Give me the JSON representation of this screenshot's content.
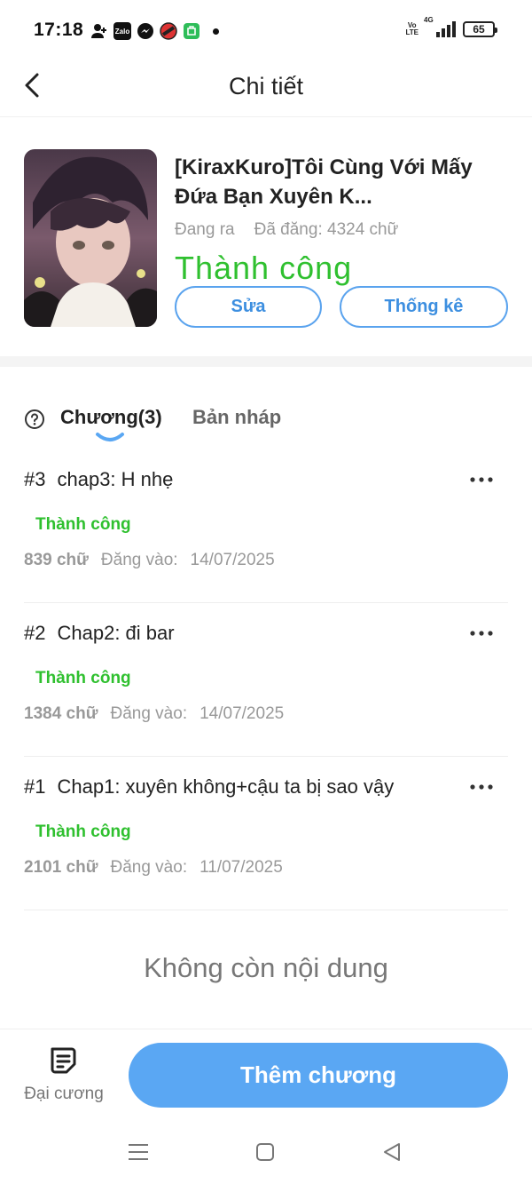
{
  "status_bar": {
    "time": "17:18",
    "battery": "65",
    "network": "4G",
    "volte_top": "Vo",
    "volte_bottom": "LTE"
  },
  "header": {
    "title": "Chi tiết"
  },
  "story": {
    "title": "[KiraxKuro]Tôi Cùng Với Mấy Đứa Bạn Xuyên K...",
    "status_text": "Đang ra",
    "word_count": "Đã đăng: 4324 chữ",
    "review_status": "Thành  công",
    "edit_label": "Sửa",
    "stats_label": "Thống kê"
  },
  "tabs": {
    "chapters_label": "Chương(3)",
    "drafts_label": "Bản nháp"
  },
  "chapters": [
    {
      "number": "#3",
      "title": "chap3: H nhẹ",
      "status": "Thành công",
      "words": "839 chữ",
      "date_label": "Đăng vào:",
      "date": "14/07/2025"
    },
    {
      "number": "#2",
      "title": "Chap2: đi bar",
      "status": "Thành công",
      "words": "1384 chữ",
      "date_label": "Đăng vào:",
      "date": "14/07/2025"
    },
    {
      "number": "#1",
      "title": "Chap1: xuyên không+cậu ta bị sao vậy",
      "status": "Thành công",
      "words": "2101 chữ",
      "date_label": "Đăng vào:",
      "date": "11/07/2025"
    }
  ],
  "end_message": "Không còn nội dung",
  "bottom": {
    "outline_label": "Đại cương",
    "add_chapter_label": "Thêm chương"
  },
  "colors": {
    "accent_blue": "#5aa7f3",
    "success_green": "#2fc02f",
    "muted_gray": "#999999"
  },
  "icons": [
    "back-arrow-icon",
    "help-circle-icon",
    "more-dots-icon",
    "outline-document-icon",
    "menu-lines-icon",
    "home-square-icon",
    "back-triangle-icon",
    "add-contact-icon",
    "zalo-icon",
    "messenger-icon",
    "app-icon",
    "store-icon"
  ]
}
